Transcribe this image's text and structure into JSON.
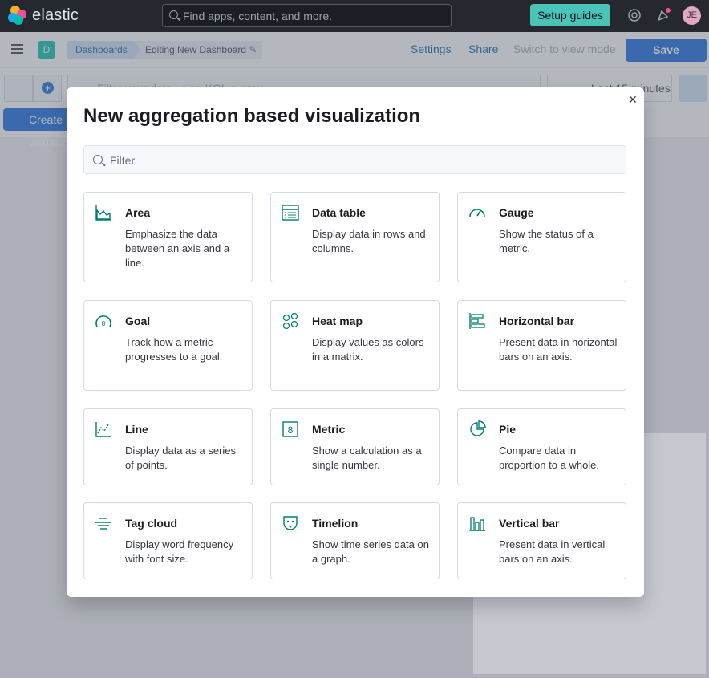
{
  "header": {
    "brand": "elastic",
    "search_placeholder": "Find apps, content, and more.",
    "setup_guides_label": "Setup guides",
    "user_initials": "JE"
  },
  "app_bar": {
    "space_initial": "D",
    "breadcrumbs": [
      "Dashboards",
      "Editing New Dashboard"
    ],
    "settings_label": "Settings",
    "share_label": "Share",
    "switch_view_label": "Switch to view mode",
    "save_label": "Save"
  },
  "query_bar": {
    "kql_placeholder": "Filter your data using KQL syntax",
    "time_label": "Last 15 minutes",
    "create_label": "Create visualization"
  },
  "modal": {
    "title": "New aggregation based visualization",
    "filter_placeholder": "Filter",
    "cards": [
      {
        "title": "Area",
        "description": "Emphasize the data between an axis and a line.",
        "icon": "area-chart-icon"
      },
      {
        "title": "Data table",
        "description": "Display data in rows and columns.",
        "icon": "table-icon"
      },
      {
        "title": "Gauge",
        "description": "Show the status of a metric.",
        "icon": "gauge-icon"
      },
      {
        "title": "Goal",
        "description": "Track how a metric progresses to a goal.",
        "icon": "goal-icon"
      },
      {
        "title": "Heat map",
        "description": "Display values as colors in a matrix.",
        "icon": "heatmap-icon"
      },
      {
        "title": "Horizontal bar",
        "description": "Present data in horizontal bars on an axis.",
        "icon": "horizontal-bar-icon"
      },
      {
        "title": "Line",
        "description": "Display data as a series of points.",
        "icon": "line-chart-icon"
      },
      {
        "title": "Metric",
        "description": "Show a calculation as a single number.",
        "icon": "metric-icon"
      },
      {
        "title": "Pie",
        "description": "Compare data in proportion to a whole.",
        "icon": "pie-chart-icon"
      },
      {
        "title": "Tag cloud",
        "description": "Display word frequency with font size.",
        "icon": "tag-cloud-icon"
      },
      {
        "title": "Timelion",
        "description": "Show time series data on a graph.",
        "icon": "timelion-icon"
      },
      {
        "title": "Vertical bar",
        "description": "Present data in vertical bars on an axis.",
        "icon": "vertical-bar-icon"
      }
    ]
  },
  "colors": {
    "accent": "#0b64dd",
    "icon_teal": "#017d73",
    "setup_button": "#48c5b6",
    "header_bg": "#25282f"
  }
}
